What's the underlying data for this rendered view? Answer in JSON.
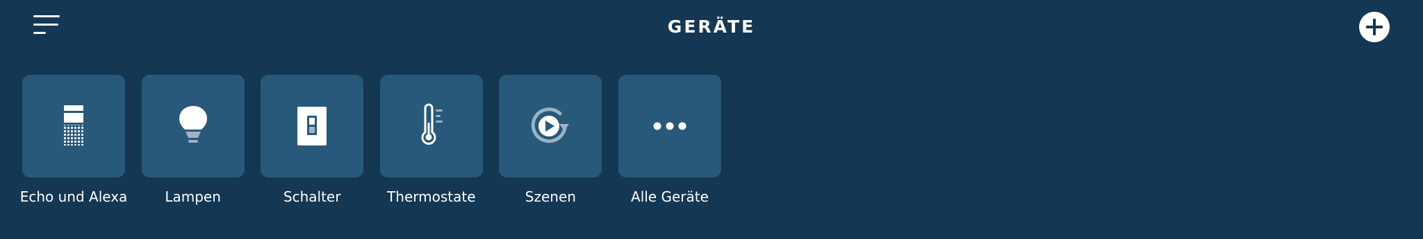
{
  "header": {
    "title": "GERÄTE",
    "menu_icon": "hamburger-menu-icon",
    "add_icon": "plus-circle-icon"
  },
  "categories": [
    {
      "label": "Echo und Alexa",
      "icon": "echo-speaker-icon"
    },
    {
      "label": "Lampen",
      "icon": "light-bulb-icon"
    },
    {
      "label": "Schalter",
      "icon": "light-switch-icon"
    },
    {
      "label": "Thermostate",
      "icon": "thermometer-icon"
    },
    {
      "label": "Szenen",
      "icon": "scene-play-icon"
    },
    {
      "label": "Alle Geräte",
      "icon": "more-dots-icon"
    }
  ],
  "colors": {
    "background": "#143754",
    "tile": "#28587a",
    "text": "#ffffff"
  }
}
